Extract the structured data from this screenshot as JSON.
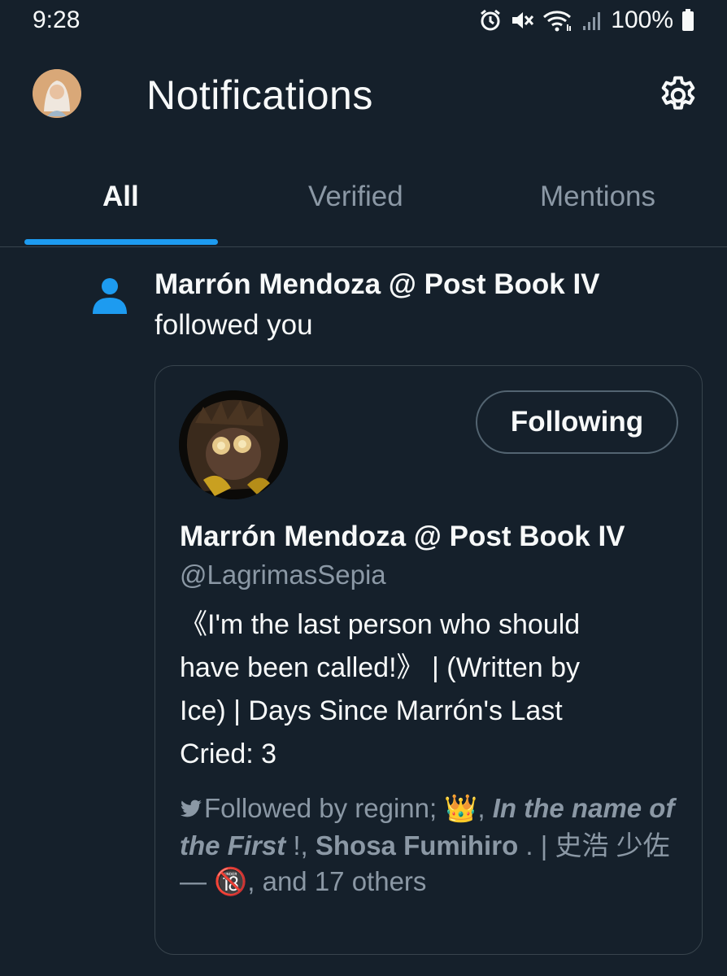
{
  "status_bar": {
    "time": "9:28",
    "battery": "100%",
    "icons": [
      "alarm-icon",
      "mute-icon",
      "wifi-icon",
      "signal-icon",
      "battery-icon"
    ]
  },
  "header": {
    "title": "Notifications",
    "settings_icon": "gear-icon"
  },
  "tabs": [
    {
      "label": "All",
      "active": true
    },
    {
      "label": "Verified",
      "active": false
    },
    {
      "label": "Mentions",
      "active": false
    }
  ],
  "notification": {
    "icon": "person-icon",
    "name": "Marrón Mendoza @ Post Book IV",
    "action": "followed you",
    "card": {
      "button_label": "Following",
      "name": "Marrón Mendoza @ Post Book IV",
      "handle": "@LagrimasSepia",
      "bio_line1": "《I'm the last person who should",
      "bio_line2": "have been called!》 | (Written by",
      "bio_line3": "Ice) | Days Since Marrón's Last",
      "bio_line4": "Cried: 3",
      "followed_by": {
        "prefix": "Followed by reginn; ",
        "emoji_crown": "👑",
        "part_italic": "In the name of the First",
        "sep1": " !, ",
        "part_bold1": "Shosa Fumihiro",
        "sep2": " . | 史浩 少佐 — ",
        "emoji_18": "🔞",
        "suffix": ", and 17 others"
      }
    }
  },
  "colors": {
    "background": "#15202b",
    "accent": "#1d9bf0",
    "text_primary": "#f7f9f9",
    "text_secondary": "#8b98a5",
    "border": "#38444d"
  }
}
